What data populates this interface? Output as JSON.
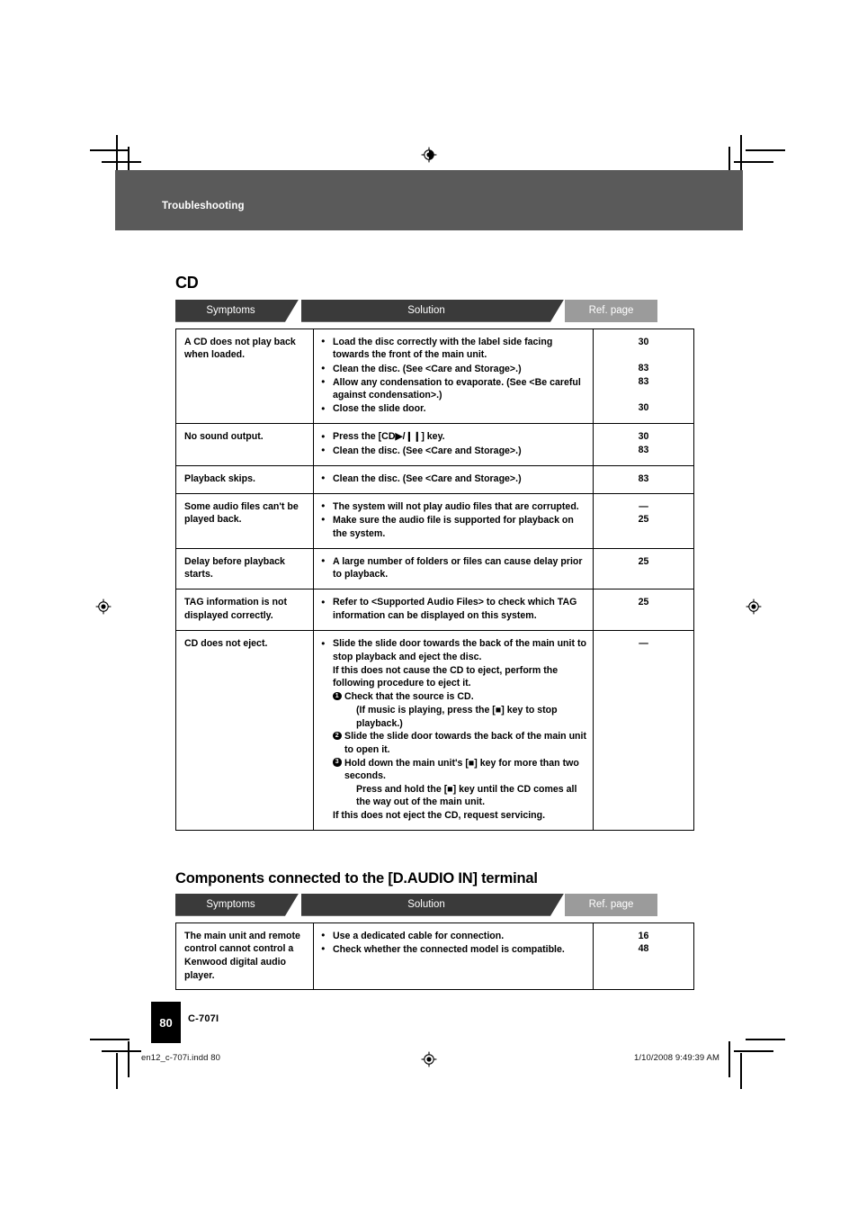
{
  "page": {
    "running_header": "Troubleshooting",
    "page_number": "80",
    "model": "C-707I",
    "indd_filename": "en12_c-707i.indd   80",
    "print_timestamp": "1/10/2008   9:49:39 AM",
    "bar_color": "#5a5a5a",
    "header_dark": "#3a3a3a",
    "header_light": "#9b9b9b"
  },
  "columns": {
    "symptoms": "Symptoms",
    "solution": "Solution",
    "ref_page": "Ref. page"
  },
  "sections": [
    {
      "title": "CD",
      "rows": [
        {
          "symptom": "A CD does not play back when loaded.",
          "solutions": [
            "Load the disc correctly with the label side facing towards the front of the main unit.",
            "Clean the disc. (See <Care and Storage>.)",
            "Allow any condensation to evaporate. (See <Be careful against condensation>.)",
            "Close the slide door."
          ],
          "refs": [
            "30",
            "",
            "83",
            "83",
            "",
            "30"
          ]
        },
        {
          "symptom": "No sound output.",
          "solutions": [
            "Press the [CD▶/❙❙] key.",
            "Clean the disc. (See <Care and Storage>.)"
          ],
          "refs": [
            "30",
            "83"
          ]
        },
        {
          "symptom": "Playback skips.",
          "solutions": [
            "Clean the disc. (See <Care and Storage>.)"
          ],
          "refs": [
            "83"
          ]
        },
        {
          "symptom": "Some audio files can't be played back.",
          "solutions": [
            "The system will not play audio files that are corrupted.",
            "Make sure the audio file is supported for playback on the system."
          ],
          "refs": [
            "—",
            "25"
          ]
        },
        {
          "symptom": "Delay before playback starts.",
          "solutions": [
            "A large number of folders or files can cause delay prior to playback."
          ],
          "refs": [
            "25"
          ]
        },
        {
          "symptom": "TAG information is not displayed correctly.",
          "solutions": [
            "Refer to <Supported Audio Files> to check which TAG information can be displayed on this system."
          ],
          "refs": [
            "25"
          ]
        },
        {
          "symptom": "CD does not eject.",
          "eject": {
            "bullet": "Slide the slide door towards the back of the main unit to stop playback and eject the disc.",
            "intro": "If this does not cause the CD to eject, perform the following procedure to eject it.",
            "steps": [
              {
                "num": "1",
                "text": "Check that the source is CD.",
                "sub": "(If music is playing, press the [■] key to stop playback.)"
              },
              {
                "num": "2",
                "text": "Slide the slide door towards the back of the main unit to open it.",
                "sub": ""
              },
              {
                "num": "3",
                "text": "Hold down the main unit's [■] key for more than two seconds.",
                "sub": "Press and hold the [■] key until the CD comes all the way out of the main unit."
              }
            ],
            "closing": "If this does not eject the CD, request servicing."
          },
          "refs": [
            "—"
          ]
        }
      ]
    },
    {
      "title": "Components connected to the [D.AUDIO IN] terminal",
      "rows": [
        {
          "symptom": "The main unit and remote control cannot control a Kenwood digital audio player.",
          "solutions": [
            "Use a dedicated cable for connection.",
            "Check whether the connected model is compatible."
          ],
          "refs": [
            "16",
            "48"
          ]
        }
      ]
    }
  ]
}
